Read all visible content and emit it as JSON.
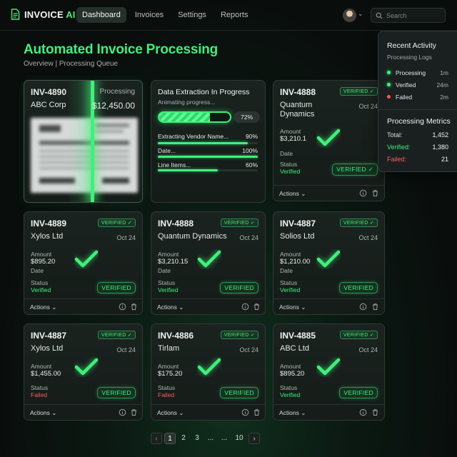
{
  "brand": {
    "name": "INVOICE",
    "ai": "AI"
  },
  "nav": [
    "Dashboard",
    "Invoices",
    "Settings",
    "Reports"
  ],
  "search": {
    "placeholder": "Search"
  },
  "page": {
    "title": "Automated Invoice Processing",
    "breadcrumb": "Overview | Processing Queue"
  },
  "processing_card": {
    "id": "INV-4890",
    "status": "Processing",
    "vendor": "ABC Corp",
    "amount": "$12,450.00"
  },
  "extraction_card": {
    "title": "Data Extraction In Progress",
    "subtitle": "Animating progress...",
    "overall_percent": 72,
    "overall_label": "72%",
    "rows": [
      {
        "label": "Extracting Vendor Name...",
        "percent": 90,
        "percent_label": "90%"
      },
      {
        "label": "Date...",
        "percent": 100,
        "percent_label": "100%"
      },
      {
        "label": "Line Items...",
        "percent": 60,
        "percent_label": "60%"
      }
    ]
  },
  "labels": {
    "amount": "Amount",
    "date": "Date",
    "status": "Status",
    "actions": "Actions",
    "verified_badge": "VERIFIED",
    "verified_pill": "VERIFIED"
  },
  "invoices": [
    {
      "id": "INV-4888",
      "vendor": "Quantum Dynamics",
      "date": "Oct 24",
      "amount": "$3,210.1",
      "status": "Verified"
    },
    {
      "id": "INV-4889",
      "vendor": "Xylos Ltd",
      "date": "Oct 24",
      "amount": "$895.20",
      "status": "Verified"
    },
    {
      "id": "INV-4888",
      "vendor": "Quantum Dynamics",
      "date": "Oct 24",
      "amount": "$3,210.15",
      "status": "Verified"
    },
    {
      "id": "INV-4887",
      "vendor": "Solios Ltd",
      "date": "Oct 24",
      "amount": "$1,210.00",
      "status": "Verified"
    },
    {
      "id": "INV-4887",
      "vendor": "Xylos Ltd",
      "date": "Oct 24",
      "amount": "$1,455.00",
      "status": "Failed"
    },
    {
      "id": "INV-4886",
      "vendor": "Tirlam",
      "date": "Oct 24",
      "amount": "$175.20",
      "status": "Failed"
    },
    {
      "id": "INV-4885",
      "vendor": "ABC Ltd",
      "date": "Oct 24",
      "amount": "$895.20",
      "status": "Verified"
    }
  ],
  "activity": {
    "title": "Recent Activity",
    "subtitle": "Processing Logs",
    "logs": [
      {
        "label": "Processing",
        "time": "1m",
        "color": "#3ff07a"
      },
      {
        "label": "Verified",
        "time": "24m",
        "color": "#3ff07a"
      },
      {
        "label": "Failed",
        "time": "2m",
        "color": "#ff5c5c"
      }
    ]
  },
  "metrics": {
    "title": "Processing Metrics",
    "total_label": "Total:",
    "total": "1,452",
    "verified_label": "Verified:",
    "verified": "1,380",
    "failed_label": "Failed:",
    "failed": "21"
  },
  "pagination": {
    "prev": "‹",
    "pages": [
      "1",
      "2",
      "3",
      "...",
      "...",
      "10"
    ],
    "next": "›",
    "active": "1"
  },
  "colors": {
    "accent": "#3ff07a",
    "failed": "#ff5c5c"
  }
}
